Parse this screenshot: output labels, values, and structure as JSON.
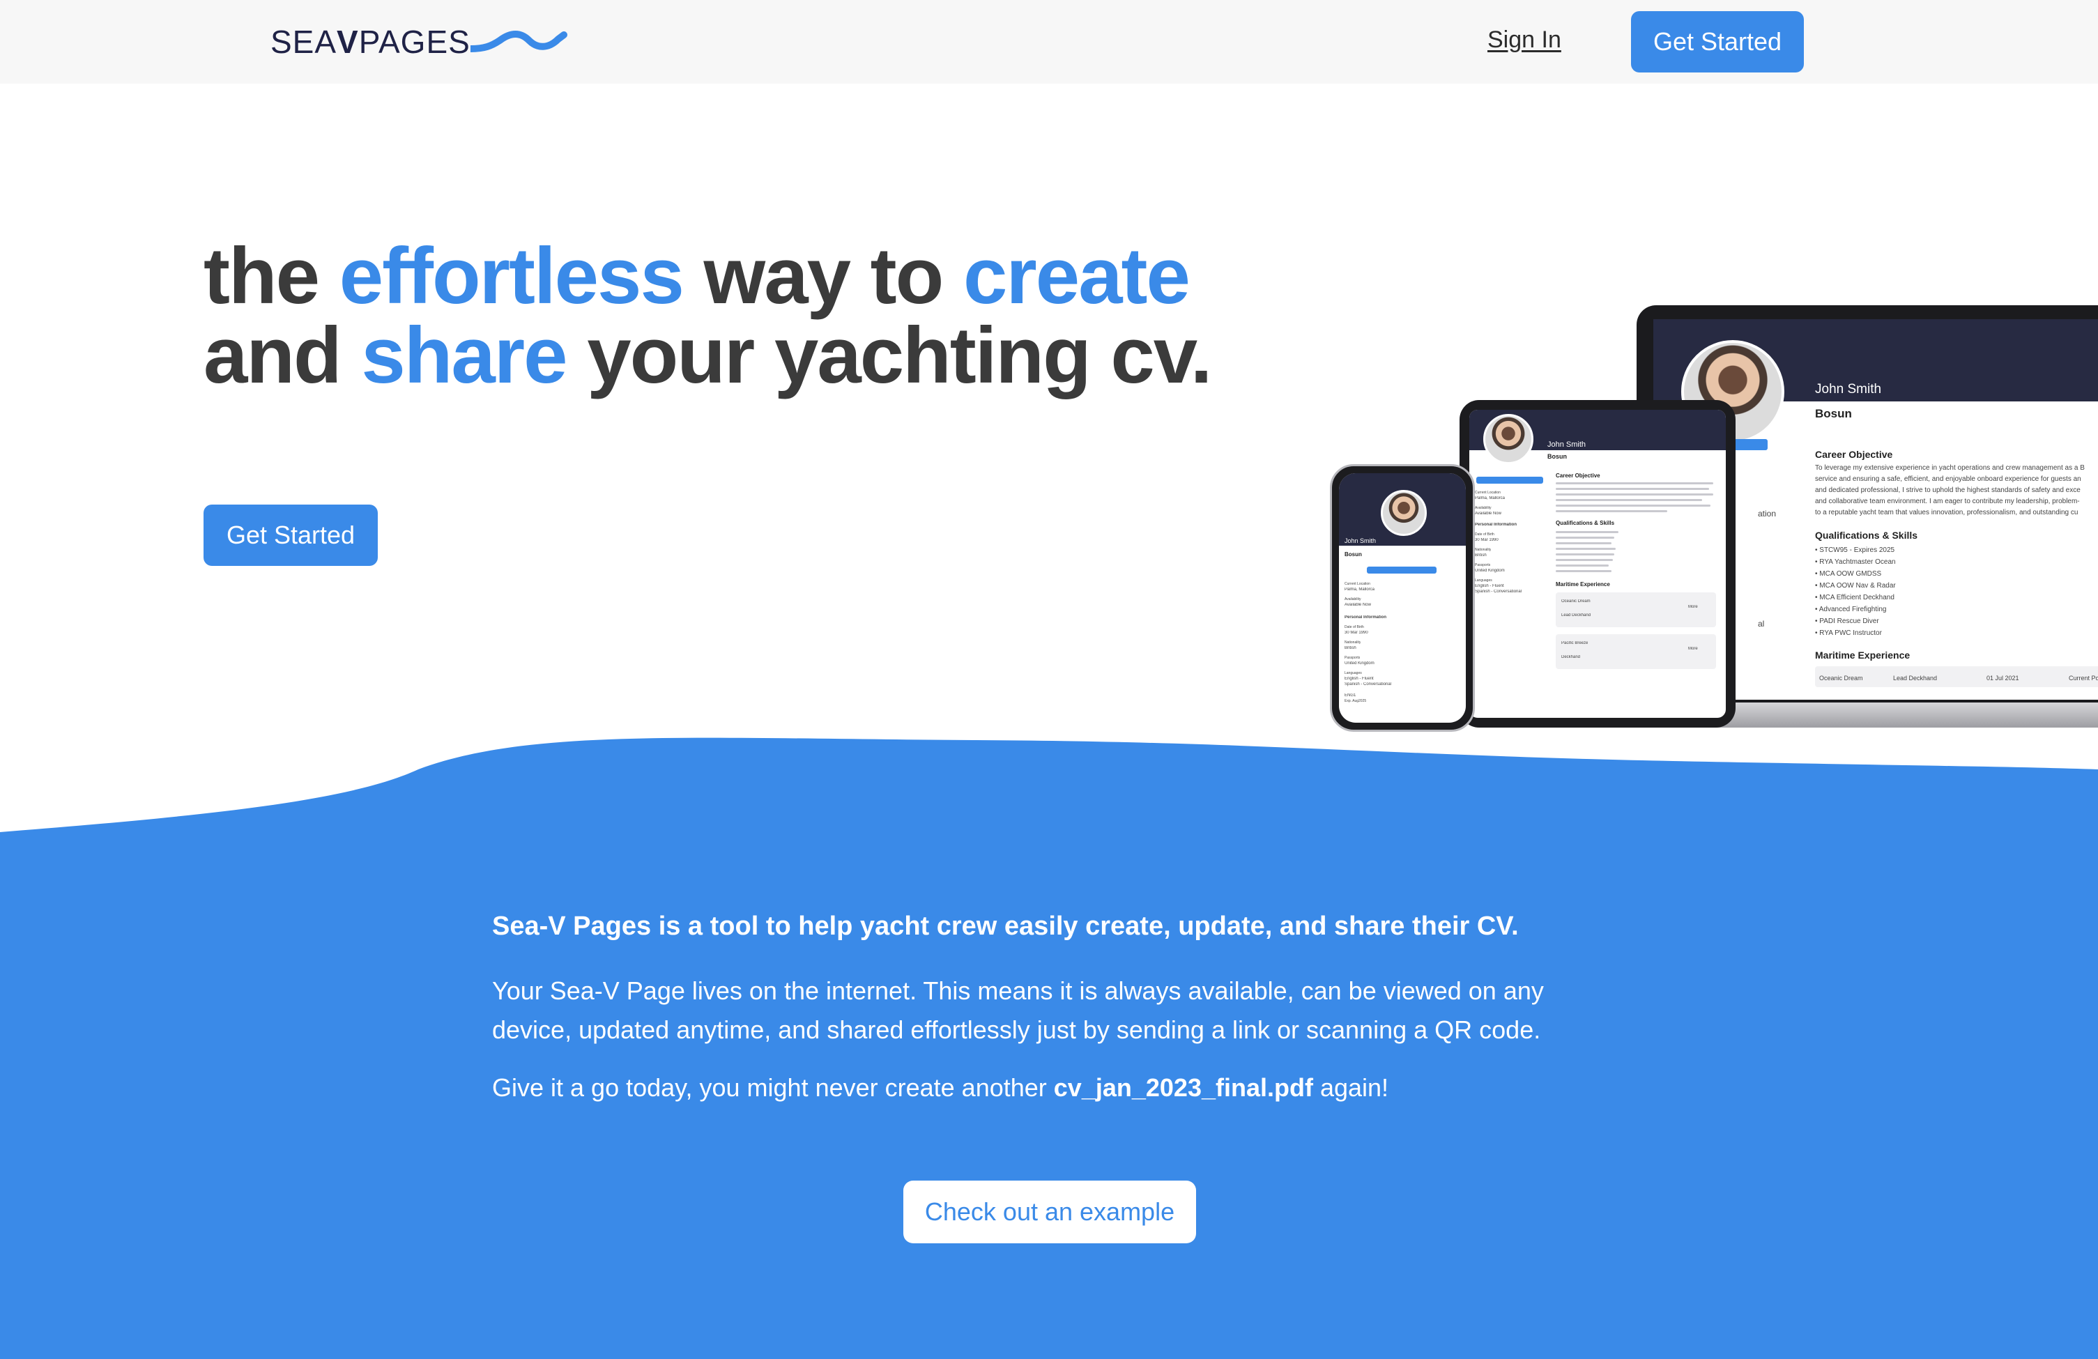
{
  "header": {
    "logo": {
      "word_a": "SEA",
      "word_mark": "V",
      "word_b": "PAGES"
    },
    "sign_in": "Sign In",
    "cta": "Get Started"
  },
  "hero": {
    "title_line1": {
      "a": "the ",
      "b": "effortless",
      "c": " way to ",
      "d": "create"
    },
    "title_line2": {
      "a": "and ",
      "b": "share",
      "c": " your yachting cv."
    },
    "cta": "Get Started"
  },
  "devices": {
    "laptop": {
      "name": "John Smith",
      "role": "Bosun",
      "contact": "Contact",
      "section_career": "Career Objective",
      "career_text": [
        "To leverage my extensive experience in yacht operations and crew management as a B",
        "service and ensuring a safe, efficient, and enjoyable onboard experience for guests an",
        "and dedicated professional, I strive to uphold the highest standards of safety and exce",
        "and collaborative team environment. I am eager to contribute my leadership, problem-",
        "to a reputable yacht team that values innovation, professionalism, and outstanding cu"
      ],
      "section_quals": "Qualifications & Skills",
      "quals": [
        "• STCW95 - Expires 2025",
        "• RYA Yachtmaster Ocean",
        "• MCA OOW GMDSS",
        "• MCA OOW Nav & Radar",
        "• MCA Efficient Deckhand",
        "• Advanced Firefighting",
        "• PADI Rescue Diver",
        "• RYA PWC Instructor"
      ],
      "section_maritime": "Maritime Experience",
      "exp_row": [
        "Oceanic Dream",
        "Lead Deckhand",
        "01 Jul 2021",
        "Current Positi"
      ],
      "side_fragment_a": "ation",
      "side_fragment_b": "al"
    },
    "tablet": {
      "name": "John Smith",
      "role": "Bosun",
      "contact": "Contact",
      "section_career": "Career Objective",
      "section_quals": "Qualifications & Skills",
      "section_maritime": "Maritime Experience",
      "side_labels": [
        "Current Location",
        "Palma, Mallorca",
        "Availability",
        "Available Now",
        "Personal Information",
        "Date of Birth",
        "30 Mar 1990",
        "Nationality",
        "British",
        "Passports",
        "United Kingdom",
        "Languages",
        "English - Fluent",
        "Spanish - Conversational"
      ],
      "exp_cards": [
        {
          "yacht": "Oceanic Dream",
          "position": "Lead Deckhand",
          "more": "More"
        },
        {
          "yacht": "Pacific Breeze",
          "position": "Deckhand",
          "more": "More"
        }
      ]
    },
    "phone": {
      "name": "John Smith",
      "role": "Bosun",
      "contact": "Contact",
      "side_labels": [
        "Current Location",
        "Palma, Mallorca",
        "Availability",
        "Available Now",
        "Personal Information",
        "Date of Birth",
        "30 Mar 1990",
        "Nationality",
        "British",
        "Passports",
        "United Kingdom",
        "Languages",
        "English - Fluent",
        "Spanish - Conversational",
        "ENG1",
        "Exp. Aug2025"
      ]
    }
  },
  "about": {
    "lead": "Sea-V Pages is a tool to help yacht crew easily create, update, and share their CV.",
    "body_line1": "Your Sea-V Page lives on the internet. This means it is always available, can be viewed on any",
    "body_line2": "device, updated anytime, and shared effortlessly just by sending a link or scanning a QR code.",
    "cta_prefix": "Give it a go today, you might never create another ",
    "cta_filename": "cv_jan_2023_final.pdf",
    "cta_suffix": " again!",
    "example_button": "Check out an example"
  },
  "colors": {
    "accent": "#3a8ae8",
    "heading": "#3b3b3b",
    "header_bg": "#f7f7f7",
    "logo": "#1f2246",
    "cv_banner": "#272a42"
  }
}
